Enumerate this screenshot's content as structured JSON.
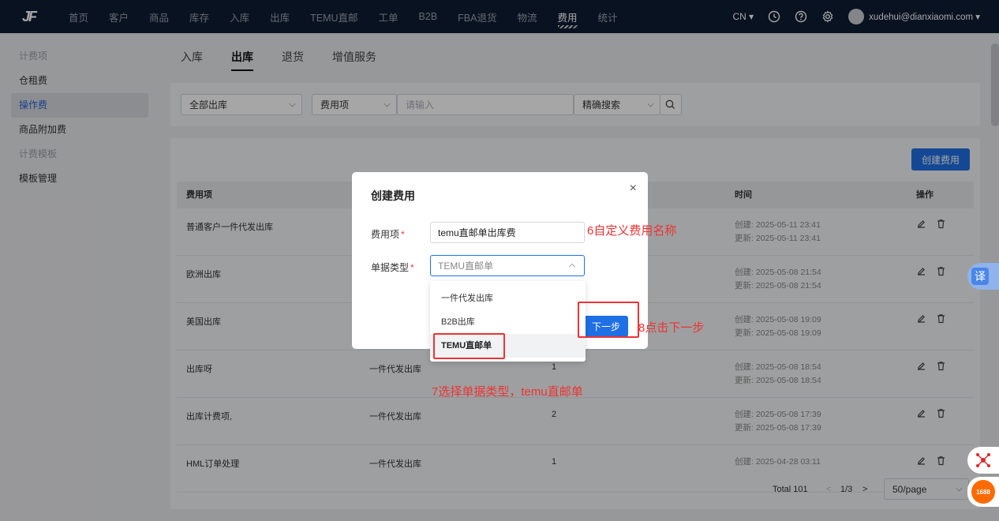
{
  "nav": {
    "logo": "JF",
    "items": [
      "首页",
      "客户",
      "商品",
      "库存",
      "入库",
      "出库",
      "TEMU直邮",
      "工单",
      "B2B",
      "FBA退货",
      "物流",
      "费用",
      "统计"
    ],
    "active_index": 11,
    "lang": "CN ▾",
    "user": "xudehui@dianxiaomi.com ▾"
  },
  "sidebar": {
    "groups": [
      {
        "title": "计费项",
        "items": [
          "仓租费",
          "操作费",
          "商品附加费"
        ]
      },
      {
        "title": "计费模板",
        "items": [
          "模板管理"
        ]
      }
    ],
    "active_item": "操作费"
  },
  "tabs": {
    "items": [
      "入库",
      "出库",
      "退货",
      "增值服务"
    ],
    "active_index": 1
  },
  "filters": {
    "scope": "全部出库",
    "field": "费用项",
    "search_placeholder": "请输入",
    "mode": "精确搜索"
  },
  "table": {
    "create_label": "创建费用",
    "headers": {
      "name": "费用项",
      "time": "时间",
      "ops": "操作"
    },
    "rows": [
      {
        "name": "普通客户一件代发出库",
        "type": "",
        "count": "",
        "created": "创建: 2025-05-11 23:41",
        "updated": "更新: 2025-05-11 23:41"
      },
      {
        "name": "欧洲出库",
        "type": "",
        "count": "",
        "created": "创建: 2025-05-08 21:54",
        "updated": "更新: 2025-05-08 21:54"
      },
      {
        "name": "美国出库",
        "type": "",
        "count": "",
        "created": "创建: 2025-05-08 19:09",
        "updated": "更新: 2025-05-08 19:09"
      },
      {
        "name": "出库呀",
        "type": "一件代发出库",
        "count": "1",
        "created": "创建: 2025-05-08 18:54",
        "updated": "更新: 2025-05-08 18:54"
      },
      {
        "name": "出库计费项,",
        "type": "一件代发出库",
        "count": "2",
        "created": "创建: 2025-05-08 17:39",
        "updated": "更新: 2025-05-08 17:39"
      },
      {
        "name": "HML订单处理",
        "type": "一件代发出库",
        "count": "1",
        "created": "创建: 2025-04-28 03:11",
        "updated": ""
      }
    ],
    "pager": {
      "total": "Total 101",
      "page": "1/3",
      "prev": "<",
      "next": ">",
      "size": "50/page"
    }
  },
  "modal": {
    "title": "创建费用",
    "close": "×",
    "fee_label": "费用项",
    "fee_value": "temu直邮单出库费",
    "type_label": "单据类型",
    "type_value": "TEMU直邮单",
    "required_mark": "*",
    "next_label": "下一步",
    "options": [
      "一件代发出库",
      "B2B出库",
      "TEMU直邮单"
    ],
    "selected_option_index": 2
  },
  "annotations": {
    "step6": "6自定义费用名称",
    "step7": "7选择单据类型，temu直邮单",
    "step8": "8点击下一步"
  },
  "widgets": {
    "translate": "译",
    "brand": "1688"
  },
  "colors": {
    "nav_bg": "#0f1c32",
    "primary": "#1f6fe5",
    "annotation": "#ee3333"
  }
}
